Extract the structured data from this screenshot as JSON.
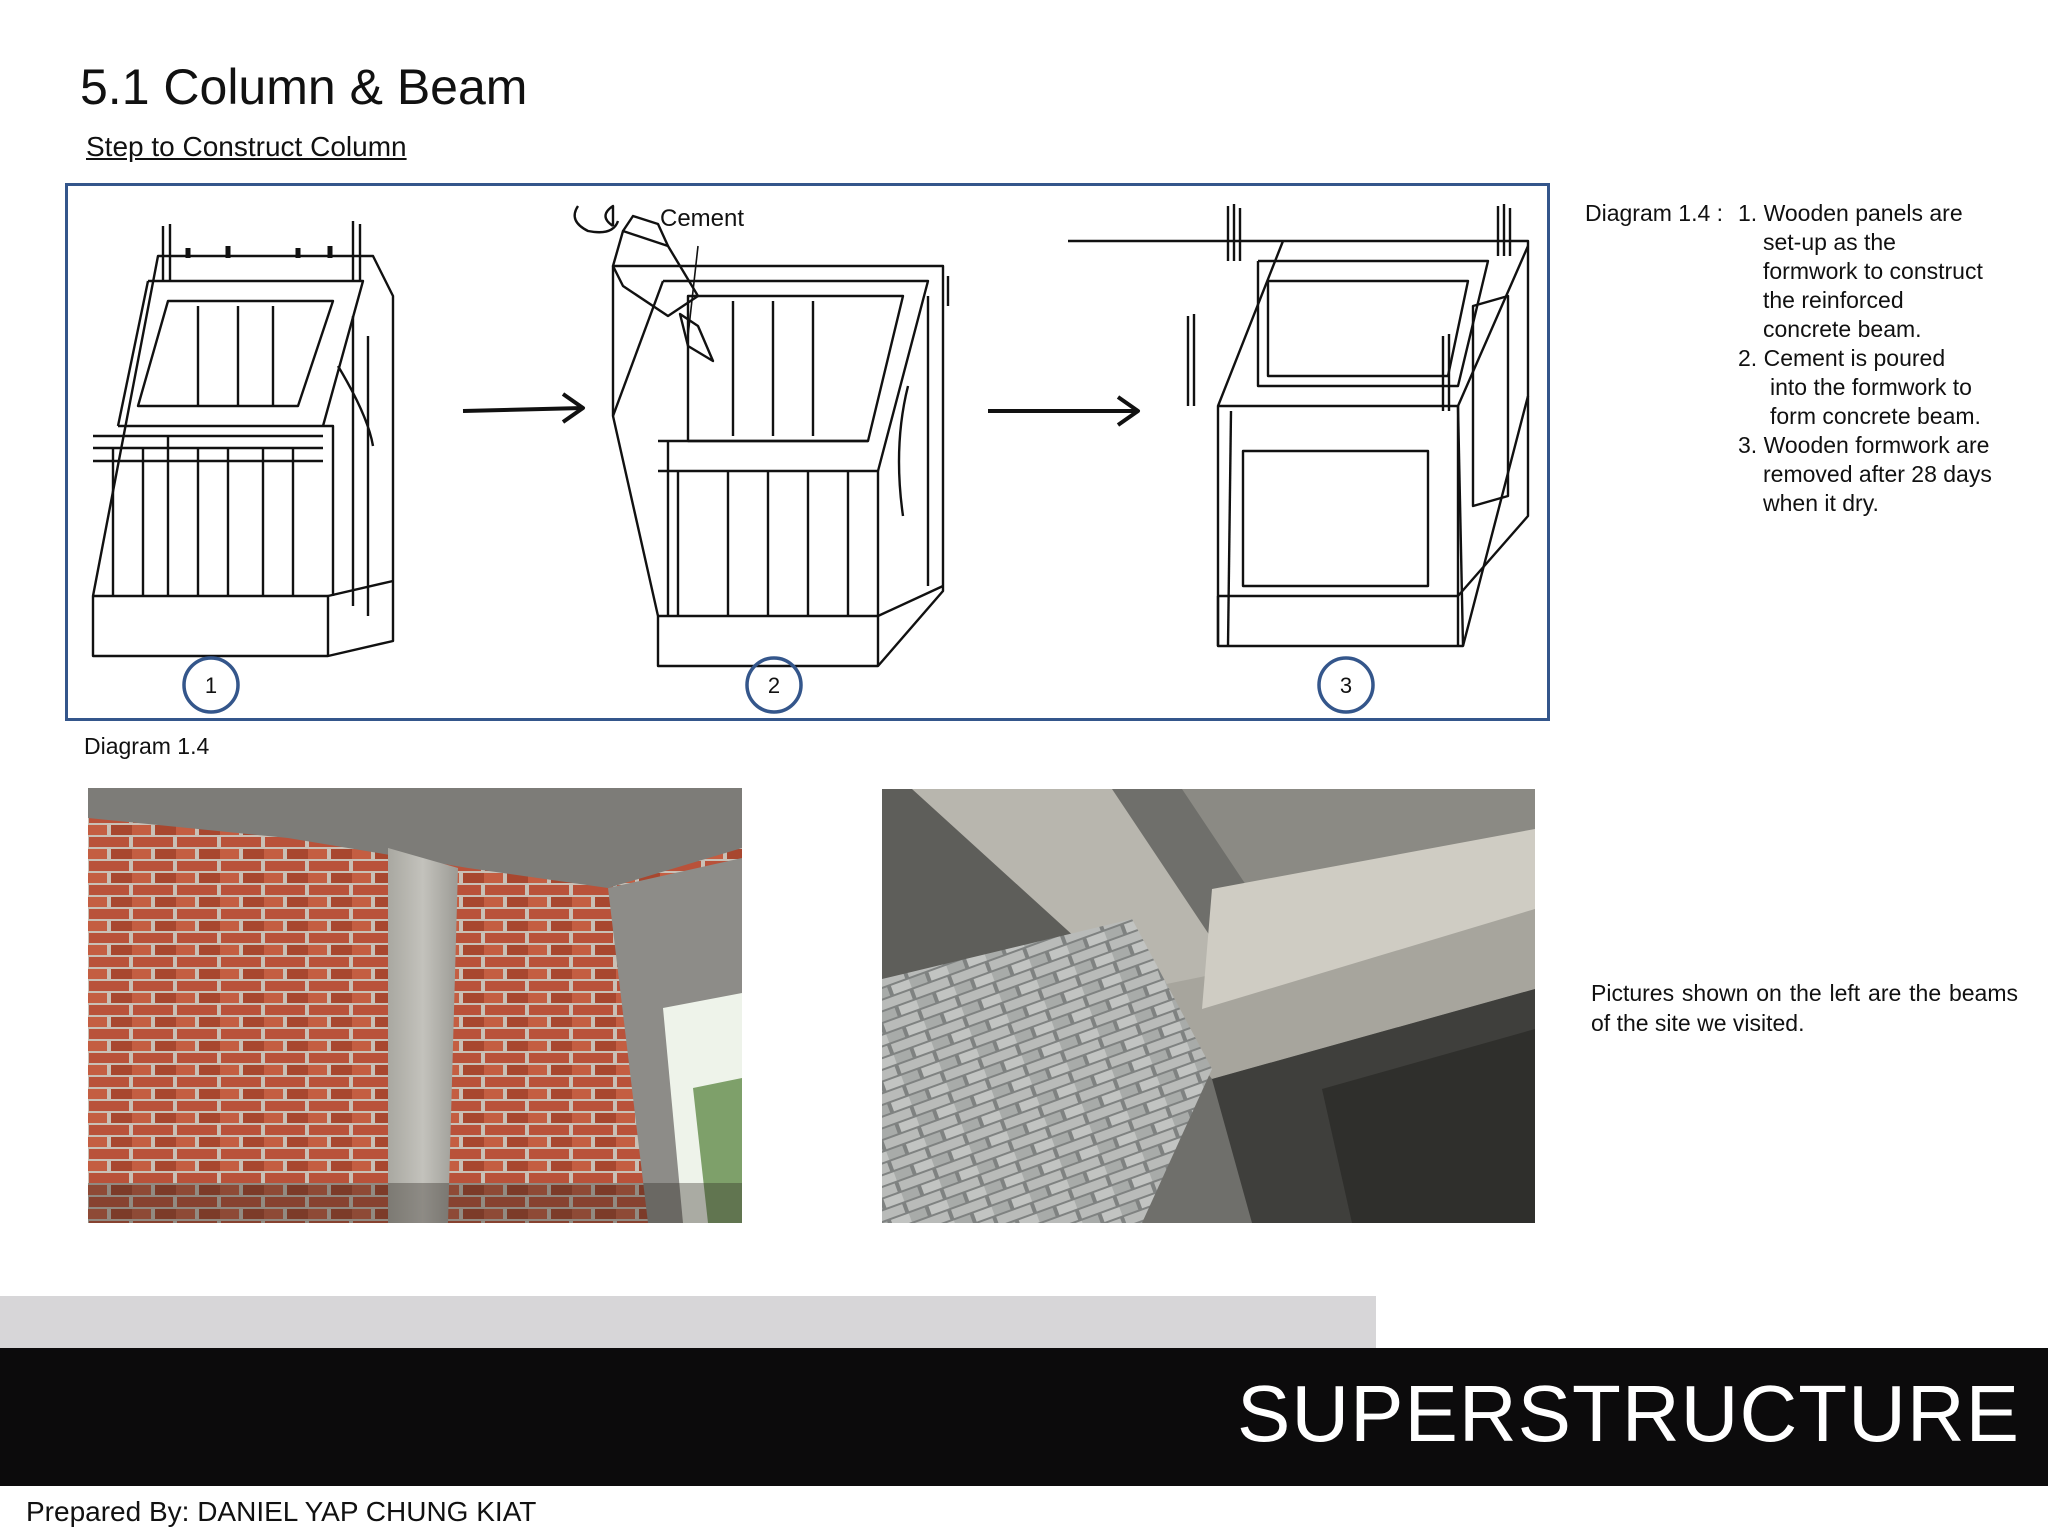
{
  "page": {
    "title": "5.1 Column & Beam",
    "subtitle": "Step to Construct Column"
  },
  "diagram": {
    "cement_label": "Cement",
    "step_numbers": [
      "1",
      "2",
      "3"
    ],
    "caption": "Diagram 1.4"
  },
  "steps": {
    "lead": "Diagram 1.4 :",
    "items": [
      {
        "number": "1.",
        "lines": [
          "Wooden panels are",
          "set-up as the",
          "formwork to construct",
          "the reinforced",
          "concrete beam."
        ]
      },
      {
        "number": "2.",
        "lines": [
          "Cement is poured",
          "into the formwork to",
          "form concrete beam."
        ]
      },
      {
        "number": "3.",
        "lines": [
          "Wooden formwork are",
          "removed after 28 days",
          "when it dry."
        ]
      }
    ]
  },
  "photos": {
    "note": "Pictures shown on the left are the beams of the site we visited."
  },
  "footer": {
    "band_title": "SUPERSTRUCTURE",
    "prepared_by": "Prepared By: DANIEL YAP CHUNG KIAT"
  },
  "colors": {
    "diagram_border": "#34568b",
    "grey_band": "#d7d6d8",
    "black_band": "#0c0b0c"
  }
}
